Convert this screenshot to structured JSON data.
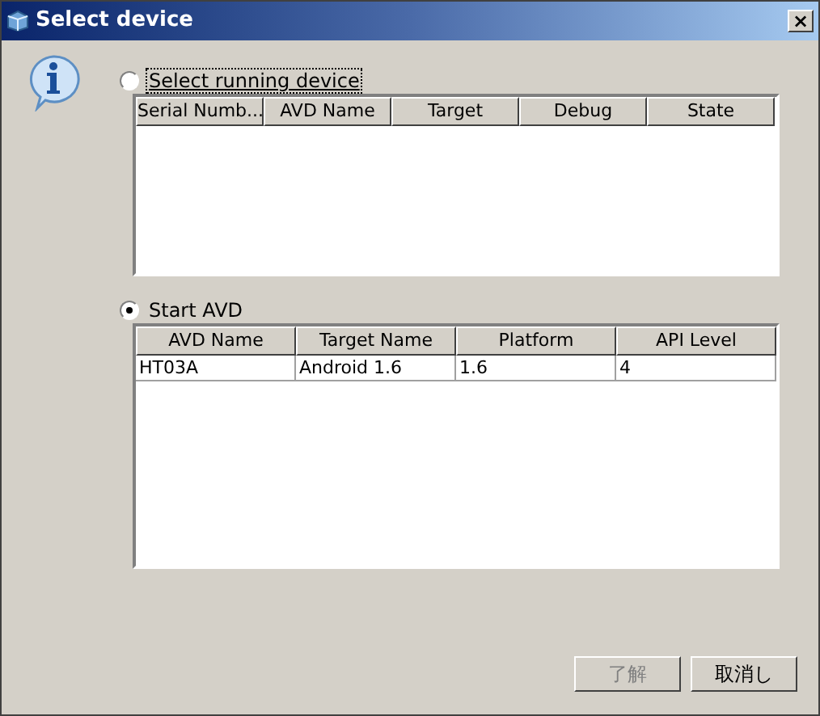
{
  "window": {
    "title": "Select device",
    "close": "×"
  },
  "options": [
    {
      "label": "Select running device",
      "selected": false,
      "focused": true,
      "table": {
        "columns": [
          "Serial Numb...",
          "AVD Name",
          "Target",
          "Debug",
          "State"
        ]
      }
    },
    {
      "label": "Start AVD",
      "selected": true,
      "focused": false,
      "table": {
        "columns": [
          "AVD Name",
          "Target Name",
          "Platform",
          "API Level"
        ],
        "rows": [
          [
            "HT03A",
            "Android 1.6",
            "1.6",
            "4"
          ]
        ]
      }
    }
  ],
  "buttons": [
    {
      "label": "了解",
      "disabled": true
    },
    {
      "label": "取消し",
      "disabled": false
    }
  ]
}
